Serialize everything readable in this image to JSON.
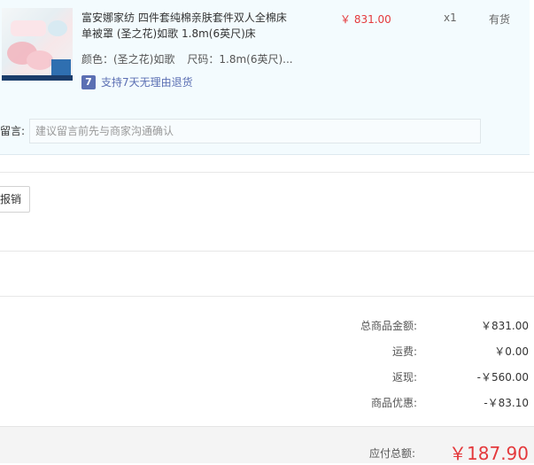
{
  "item": {
    "title": "富安娜家纺 四件套纯棉亲肤套件双人全棉床单被罩 (圣之花)如歌 1.8m(6英尺)床",
    "price": "￥ 831.00",
    "quantity": "x1",
    "stock": "有货",
    "color": "颜色：(圣之花)如歌",
    "size": "尺码：1.8m(6英尺)...",
    "return_badge": "7",
    "return_text": "支持7天无理由退货"
  },
  "note": {
    "label": "留言:",
    "placeholder": "建议留言前先与商家沟通确认"
  },
  "invoice": {
    "button_label": "报销"
  },
  "summary": [
    {
      "label": "总商品金额:",
      "value": "￥831.00"
    },
    {
      "label": "运费:",
      "value": "￥0.00"
    },
    {
      "label": "返现:",
      "value": "-￥560.00"
    },
    {
      "label": "商品优惠:",
      "value": "-￥83.10"
    }
  ],
  "total": {
    "label": "应付总额:",
    "value": "￥187.90"
  },
  "colors": {
    "accent_red": "#e4393c",
    "return_blue": "#5b6fb3",
    "item_bg": "#f3fbfe"
  }
}
